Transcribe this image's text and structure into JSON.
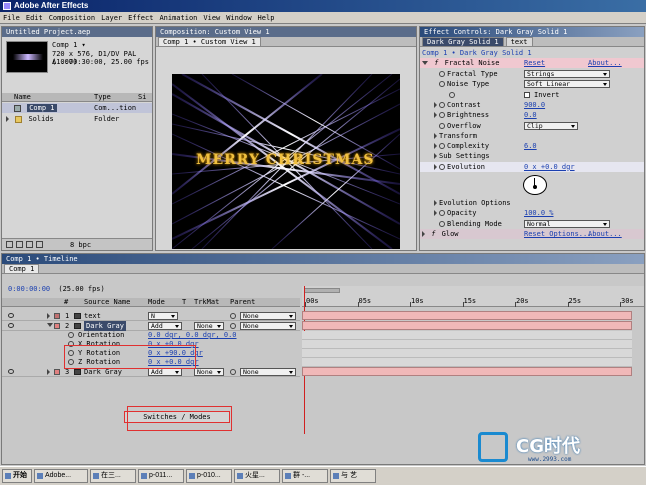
{
  "window": {
    "title": "Adobe After Effects"
  },
  "menu": [
    "File",
    "Edit",
    "Composition",
    "Layer",
    "Effect",
    "Animation",
    "View",
    "Window",
    "Help"
  ],
  "project": {
    "title": "Untitled Project.aep",
    "comp_name": "Comp 1 ▾",
    "comp_info": [
      "720 x 576, D1/DV PAL (1.07)",
      "Δ 0:00:30:00, 25.00 fps"
    ],
    "columns": [
      "Name",
      "Type",
      "Si"
    ],
    "items": [
      {
        "name": "Comp 1",
        "type": "Com...tion"
      },
      {
        "name": "Solids",
        "type": "Folder"
      }
    ],
    "bpc": "8 bpc"
  },
  "viewer": {
    "title": "Composition: Custom View 1",
    "tab": "Comp 1 • Custom View 1",
    "text": "MERRY CHRISTMAS"
  },
  "effects": {
    "title": "Effect Controls: Dark Gray Solid 1",
    "tabs": [
      "Dark Gray Solid 1",
      "text"
    ],
    "subtitle": "Comp 1 • Dark Gray Solid 1",
    "fx_name": "Fractal Noise",
    "reset": "Reset",
    "about": "About...",
    "rows": [
      {
        "label": "Fractal Type",
        "value": "Strings",
        "kind": "dd"
      },
      {
        "label": "Noise Type",
        "value": "Soft Linear",
        "kind": "dd"
      },
      {
        "label": "",
        "value": "Invert",
        "kind": "check"
      },
      {
        "label": "Contrast",
        "value": "900.0",
        "kind": "num"
      },
      {
        "label": "Brightness",
        "value": "0.0",
        "kind": "num"
      },
      {
        "label": "Overflow",
        "value": "Clip",
        "kind": "dd"
      },
      {
        "label": "Transform",
        "value": "",
        "kind": "group"
      },
      {
        "label": "Complexity",
        "value": "6.0",
        "kind": "num"
      },
      {
        "label": "Sub Settings",
        "value": "",
        "kind": "group"
      },
      {
        "label": "Evolution",
        "value": "0 x +0.0 dgr",
        "kind": "num"
      }
    ],
    "rows2": [
      {
        "label": "Evolution Options",
        "value": "",
        "kind": "group"
      },
      {
        "label": "Opacity",
        "value": "100.0 %",
        "kind": "num"
      },
      {
        "label": "Blending Mode",
        "value": "Normal",
        "kind": "dd"
      }
    ],
    "glow": {
      "name": "Glow",
      "reset": "Reset Options...",
      "about": "About..."
    }
  },
  "timeline": {
    "title": "Comp 1 • Timeline",
    "tab": "Comp 1",
    "timecode": "0:00:00:00",
    "fps": "(25.00 fps)",
    "columns": [
      "#",
      "Source Name",
      "Mode",
      "T",
      "TrkMat",
      "Parent"
    ],
    "ruler": [
      "00s",
      "05s",
      "10s",
      "15s",
      "20s",
      "25s",
      "30s"
    ],
    "layers": [
      {
        "num": "1",
        "name": "text",
        "mode": "N",
        "trk": "",
        "parent": "None"
      },
      {
        "num": "2",
        "name": "Dark Gray",
        "mode": "Add",
        "trk": "None",
        "parent": "None"
      },
      {
        "num": "3",
        "name": "Dark Gray",
        "mode": "Add",
        "trk": "None",
        "parent": "None"
      }
    ],
    "props": [
      {
        "name": "Orientation",
        "value": "0.0 dgr, 0.0 dgr, 0.0"
      },
      {
        "name": "X Rotation",
        "value": "0 x +0.0 dgr"
      },
      {
        "name": "Y Rotation",
        "value": "0 x +90.0 dgr"
      },
      {
        "name": "Z Rotation",
        "value": "0 x +0.0 dgr"
      }
    ],
    "switches": "Switches / Modes"
  },
  "taskbar": {
    "start": "开始",
    "items": [
      "Adobe...",
      "在三...",
      "p-011...",
      "p-010...",
      "火星...",
      "群 -...",
      "与 艺"
    ]
  },
  "watermark": {
    "brand": "CG时代",
    "url": "www.2993.com"
  }
}
